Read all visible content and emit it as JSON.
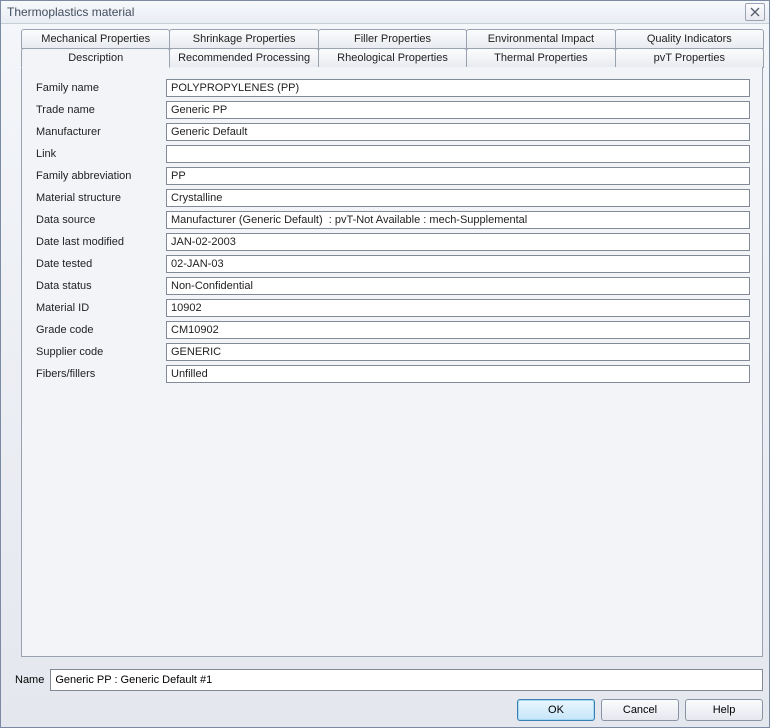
{
  "window": {
    "title": "Thermoplastics material"
  },
  "tabsRow1": [
    {
      "label": "Mechanical Properties"
    },
    {
      "label": "Shrinkage Properties"
    },
    {
      "label": "Filler Properties"
    },
    {
      "label": "Environmental Impact"
    },
    {
      "label": "Quality Indicators"
    }
  ],
  "tabsRow2": [
    {
      "label": "Description",
      "active": true
    },
    {
      "label": "Recommended Processing"
    },
    {
      "label": "Rheological Properties"
    },
    {
      "label": "Thermal Properties"
    },
    {
      "label": "pvT Properties"
    }
  ],
  "fields": [
    {
      "label": "Family name",
      "value": "POLYPROPYLENES (PP)"
    },
    {
      "label": "Trade name",
      "value": "Generic PP"
    },
    {
      "label": "Manufacturer",
      "value": "Generic Default"
    },
    {
      "label": "Link",
      "value": ""
    },
    {
      "label": "Family abbreviation",
      "value": "PP"
    },
    {
      "label": "Material structure",
      "value": "Crystalline"
    },
    {
      "label": "Data source",
      "value": "Manufacturer (Generic Default)  : pvT-Not Available : mech-Supplemental"
    },
    {
      "label": "Date last modified",
      "value": "JAN-02-2003"
    },
    {
      "label": "Date tested",
      "value": "02-JAN-03"
    },
    {
      "label": "Data status",
      "value": "Non-Confidential"
    },
    {
      "label": "Material ID",
      "value": "10902"
    },
    {
      "label": "Grade code",
      "value": "CM10902"
    },
    {
      "label": "Supplier code",
      "value": "GENERIC"
    },
    {
      "label": "Fibers/fillers",
      "value": "Unfilled"
    }
  ],
  "footer": {
    "nameLabel": "Name",
    "nameValue": "Generic PP : Generic Default #1",
    "ok": "OK",
    "cancel": "Cancel",
    "help": "Help"
  }
}
